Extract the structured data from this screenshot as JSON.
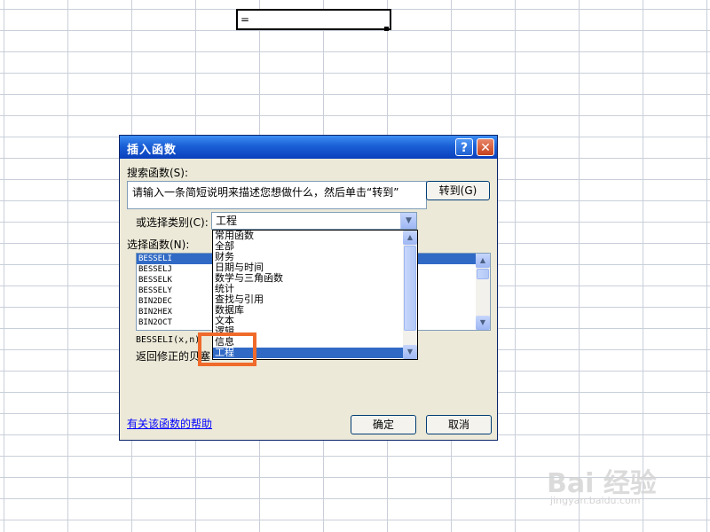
{
  "cell": {
    "value": "="
  },
  "dialog": {
    "title": "插入函数",
    "help_button": "?",
    "close_button": "✕",
    "search_label": "搜索函数(S):",
    "search_value": "请输入一条简短说明来描述您想做什么，然后单击“转到”",
    "goto_label": "转到(G)",
    "category_label": "或选择类别(C):",
    "category_value": "工程",
    "function_label": "选择函数(N):",
    "functions": [
      "BESSELI",
      "BESSELJ",
      "BESSELK",
      "BESSELY",
      "BIN2DEC",
      "BIN2HEX",
      "BIN2OCT"
    ],
    "selected_function": "BESSELI",
    "signature": "BESSELI(x,n)",
    "description": "返回修正的贝塞",
    "help_link": "有关该函数的帮助",
    "ok_label": "确定",
    "cancel_label": "取消"
  },
  "dropdown": {
    "items": [
      "常用函数",
      "全部",
      "财务",
      "日期与时间",
      "数学与三角函数",
      "统计",
      "查找与引用",
      "数据库",
      "文本",
      "逻辑",
      "信息",
      "工程"
    ],
    "selected": "工程"
  },
  "watermark": {
    "brand": "Bai 经验",
    "url": "jingyan.baidu.com"
  },
  "colors": {
    "highlight_box": "#f06a2b",
    "selection": "#316ac5",
    "titlebar": "#0a3fbc"
  }
}
